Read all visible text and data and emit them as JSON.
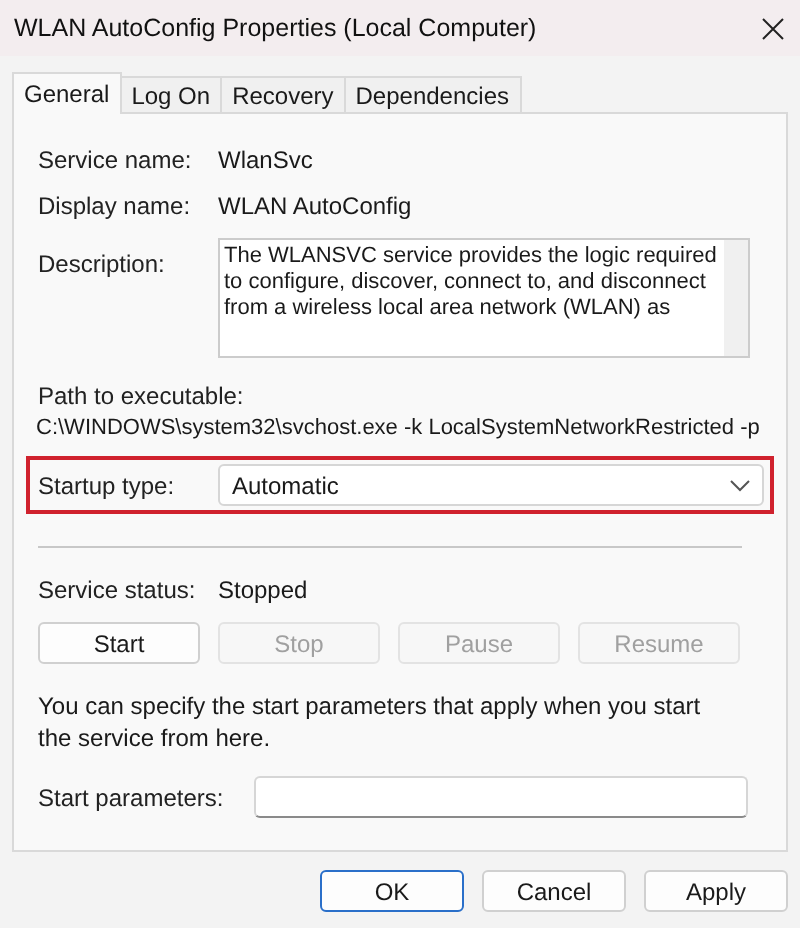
{
  "window": {
    "title": "WLAN AutoConfig Properties (Local Computer)"
  },
  "tabs": [
    {
      "label": "General",
      "selected": true
    },
    {
      "label": "Log On",
      "selected": false
    },
    {
      "label": "Recovery",
      "selected": false
    },
    {
      "label": "Dependencies",
      "selected": false
    }
  ],
  "fields": [
    {
      "label": "Service name:",
      "value": "WlanSvc"
    },
    {
      "label": "Display name:",
      "value": "WLAN AutoConfig"
    }
  ],
  "description": {
    "label": "Description:",
    "text": "The WLANSVC service provides the logic required to configure, discover, connect to, and disconnect from a wireless local area network (WLAN) as"
  },
  "path": {
    "label": "Path to executable:",
    "value": "C:\\WINDOWS\\system32\\svchost.exe -k LocalSystemNetworkRestricted -p"
  },
  "startup": {
    "label": "Startup type:",
    "value": "Automatic",
    "highlighted": true
  },
  "status": {
    "label": "Service status:",
    "value": "Stopped"
  },
  "service_buttons": [
    {
      "label": "Start",
      "disabled": false
    },
    {
      "label": "Stop",
      "disabled": true
    },
    {
      "label": "Pause",
      "disabled": true
    },
    {
      "label": "Resume",
      "disabled": true
    }
  ],
  "note": "You can specify the start parameters that apply when you start the service from here.",
  "start_parameters": {
    "label": "Start parameters:"
  },
  "dialog_buttons": [
    {
      "label": "OK",
      "default": true
    },
    {
      "label": "Cancel",
      "default": false
    },
    {
      "label": "Apply",
      "default": false
    }
  ]
}
